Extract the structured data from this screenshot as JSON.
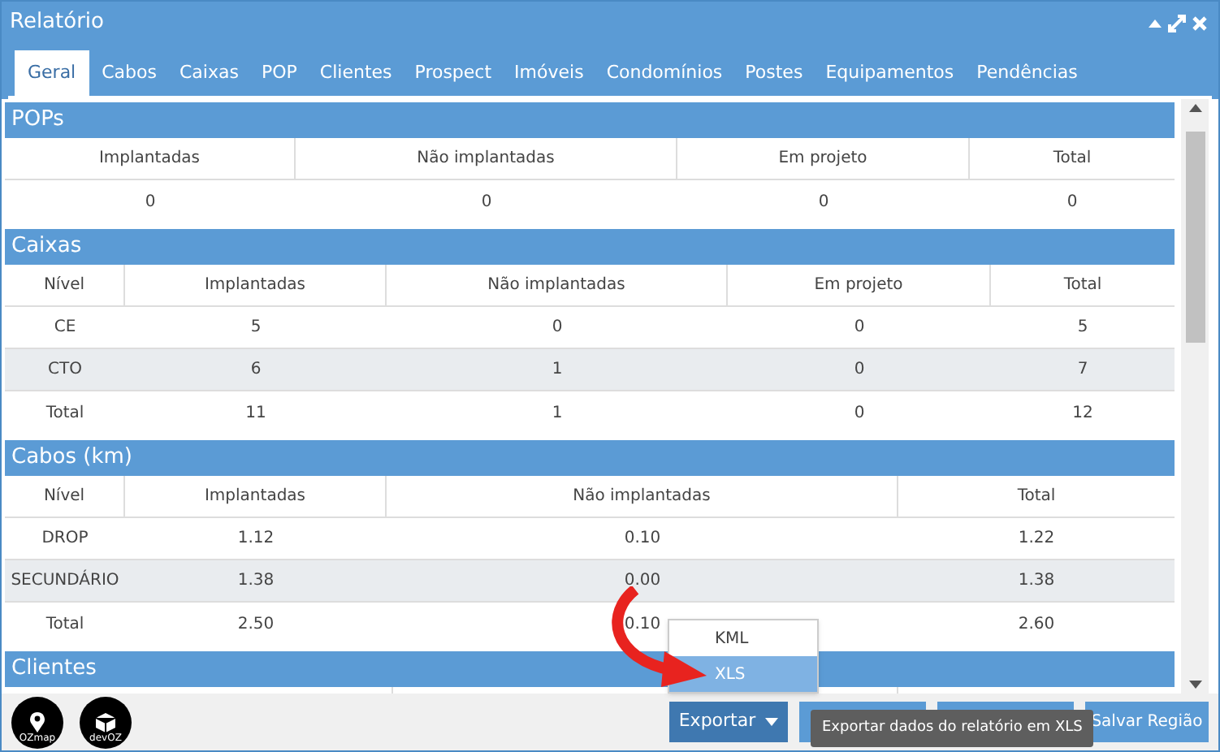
{
  "window": {
    "title": "Relatório"
  },
  "tabs": [
    {
      "label": "Geral",
      "selected": true
    },
    {
      "label": "Cabos",
      "selected": false
    },
    {
      "label": "Caixas",
      "selected": false
    },
    {
      "label": "POP",
      "selected": false
    },
    {
      "label": "Clientes",
      "selected": false
    },
    {
      "label": "Prospect",
      "selected": false
    },
    {
      "label": "Imóveis",
      "selected": false
    },
    {
      "label": "Condomínios",
      "selected": false
    },
    {
      "label": "Postes",
      "selected": false
    },
    {
      "label": "Equipamentos",
      "selected": false
    },
    {
      "label": "Pendências",
      "selected": false
    }
  ],
  "sections": [
    {
      "title": "POPs",
      "columns": [
        "Implantadas",
        "Não implantadas",
        "Em projeto",
        "Total"
      ],
      "rows": [
        [
          "0",
          "0",
          "0",
          "0"
        ]
      ]
    },
    {
      "title": "Caixas",
      "columns": [
        "Nível",
        "Implantadas",
        "Não implantadas",
        "Em projeto",
        "Total"
      ],
      "rows": [
        [
          "CE",
          "5",
          "0",
          "0",
          "5"
        ],
        [
          "CTO",
          "6",
          "1",
          "0",
          "7"
        ],
        [
          "Total",
          "11",
          "1",
          "0",
          "12"
        ]
      ]
    },
    {
      "title": "Cabos (km)",
      "columns": [
        "Nível",
        "Implantadas",
        "Não implantadas",
        "Total"
      ],
      "rows": [
        [
          "DROP",
          "1.12",
          "0.10",
          "1.22"
        ],
        [
          "SECUNDÁRIO",
          "1.38",
          "0.00",
          "1.38"
        ],
        [
          "Total",
          "2.50",
          "0.10",
          "2.60"
        ]
      ]
    },
    {
      "title": "Clientes"
    }
  ],
  "logos": [
    "OZmap",
    "devOZ"
  ],
  "export_button": {
    "label": "Exportar"
  },
  "export_menu": [
    {
      "label": "KML",
      "selected": false
    },
    {
      "label": "XLS",
      "selected": true
    }
  ],
  "tooltip": "Exportar dados do relatório em XLS",
  "save_button": {
    "label": "Salvar Região"
  }
}
